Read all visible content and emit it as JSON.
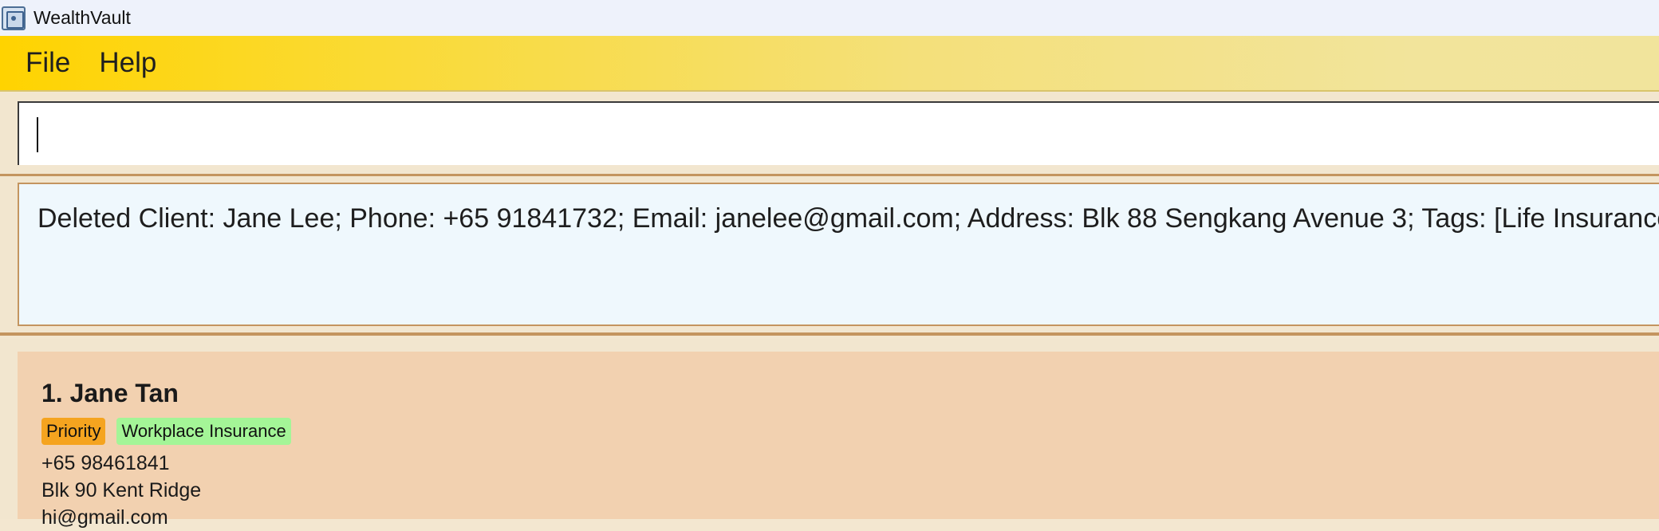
{
  "window": {
    "title": "WealthVault",
    "icon": "safe-icon"
  },
  "menu": {
    "items": [
      "File",
      "Help"
    ]
  },
  "command": {
    "value": "",
    "placeholder": ""
  },
  "result": {
    "message": "Deleted Client: Jane Lee; Phone: +65 91841732; Email: janelee@gmail.com; Address: Blk 88 Sengkang Avenue 3; Tags: [Life Insurance]"
  },
  "clients": [
    {
      "index_name": "1. Jane Tan",
      "tags": [
        "Priority",
        "Workplace Insurance"
      ],
      "phone": "+65 98461841",
      "address": "Blk 90 Kent Ridge",
      "email": "hi@gmail.com"
    }
  ],
  "colors": {
    "menu_accent": "#ffd300",
    "tag_priority": "#f5a41f",
    "tag_workplace": "#a4f597",
    "card_bg": "#f2d1b0",
    "result_bg": "#eff8fd"
  }
}
